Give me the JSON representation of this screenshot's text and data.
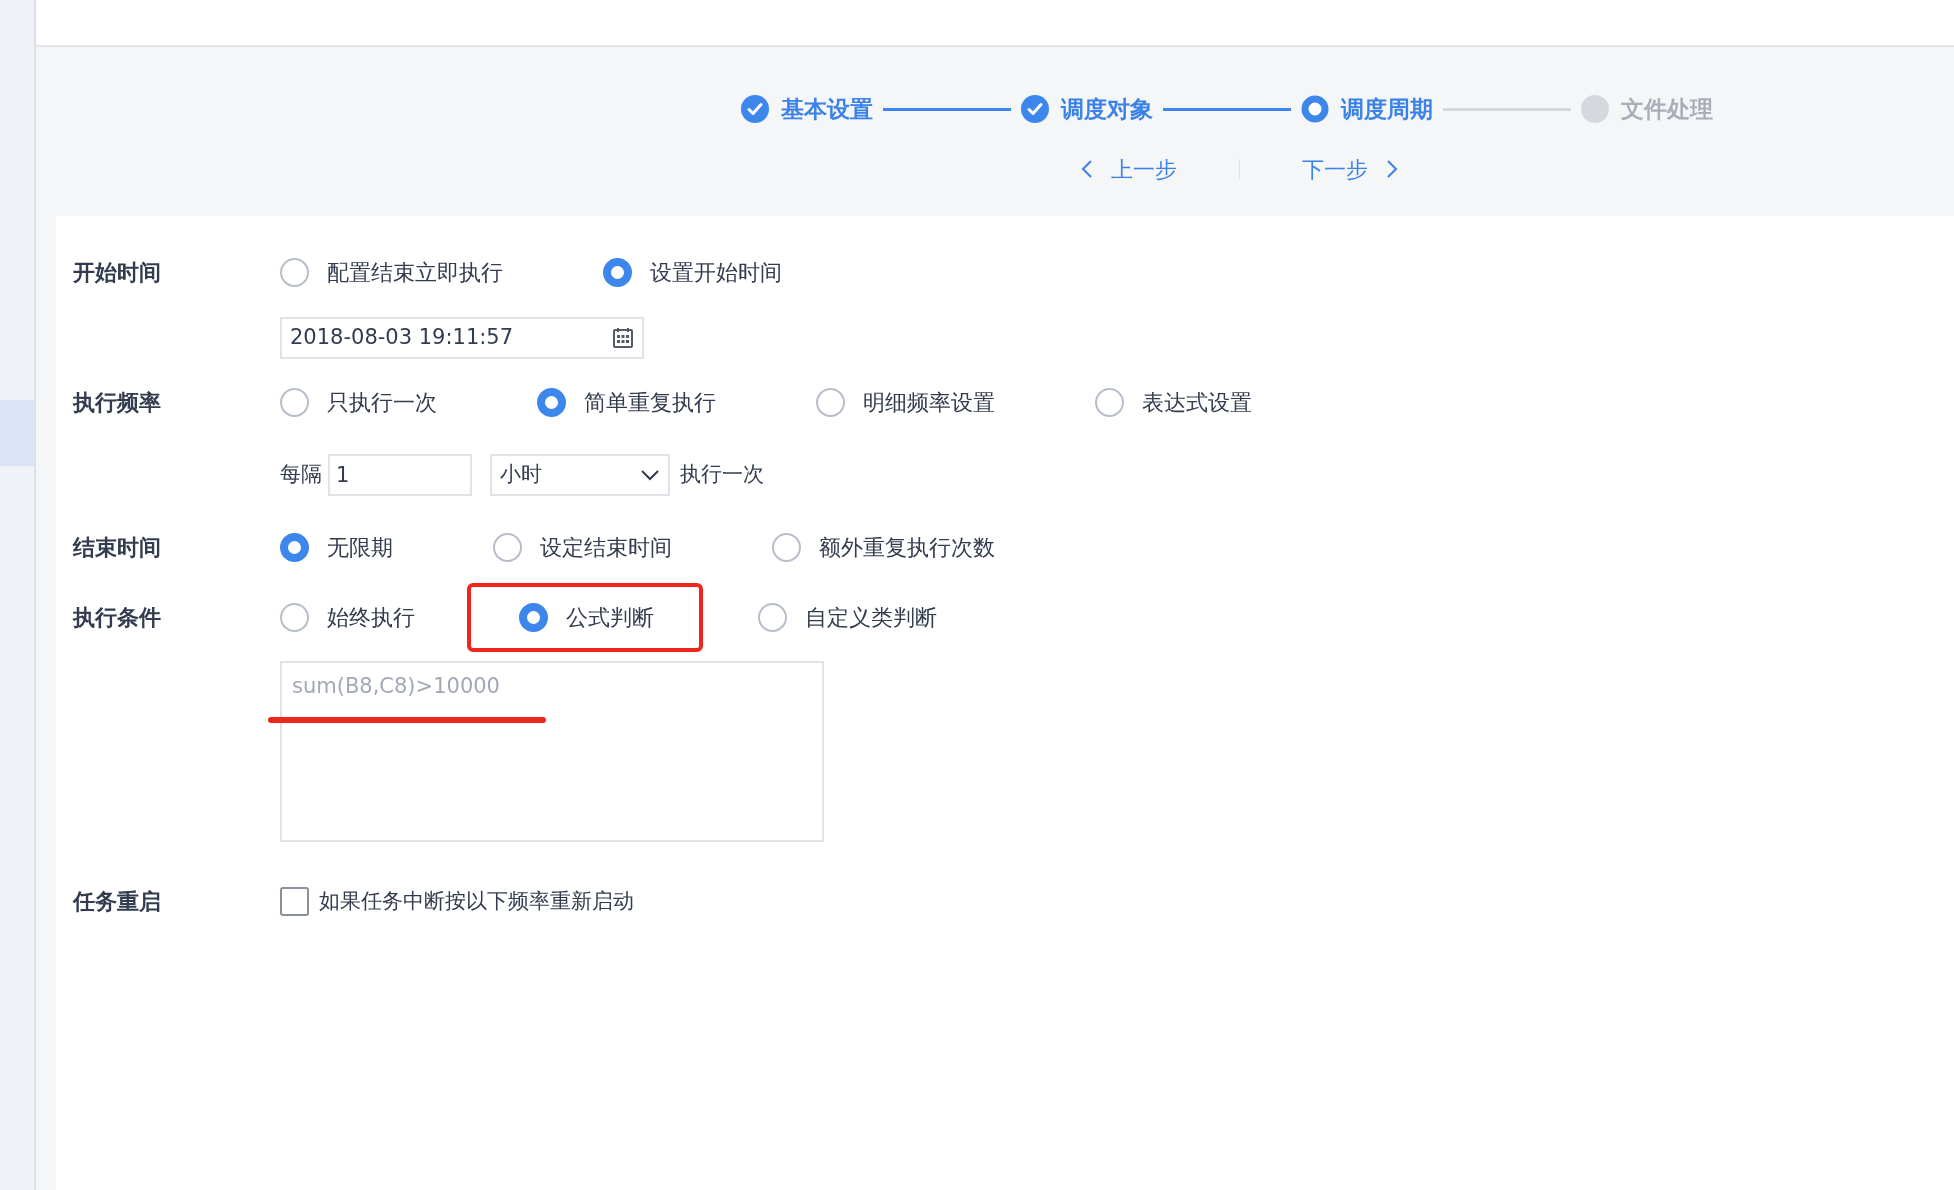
{
  "steps": [
    {
      "label": "基本设置",
      "completed": true,
      "selected": false
    },
    {
      "label": "调度对象",
      "completed": true,
      "selected": false
    },
    {
      "label": "调度周期",
      "completed": false,
      "selected": true
    },
    {
      "label": "文件处理",
      "completed": false,
      "selected": false
    }
  ],
  "nav": {
    "prev": "上一步",
    "next": "下一步"
  },
  "form": [
    {
      "label": "开始时间",
      "kind": "radios",
      "options": [
        {
          "label": "配置结束立即执行",
          "selected": false
        },
        {
          "label": "设置开始时间",
          "selected": true
        }
      ]
    },
    {
      "kind": "date",
      "value": "2018-08-03 19:11:57"
    },
    {
      "label": "执行频率",
      "kind": "radios",
      "options": [
        {
          "label": "只执行一次",
          "selected": false
        },
        {
          "label": "简单重复执行",
          "selected": true
        },
        {
          "label": "明细频率设置",
          "selected": false
        },
        {
          "label": "表达式设置",
          "selected": false
        }
      ]
    },
    {
      "kind": "interval",
      "prefix": "每隔",
      "value": "1",
      "unit": "小时",
      "suffix": "执行一次"
    },
    {
      "label": "结束时间",
      "kind": "radios",
      "options": [
        {
          "label": "无限期",
          "selected": true
        },
        {
          "label": "设定结束时间",
          "selected": false
        },
        {
          "label": "额外重复执行次数",
          "selected": false
        }
      ]
    },
    {
      "label": "执行条件",
      "kind": "radios",
      "options": [
        {
          "label": "始终执行",
          "selected": false
        },
        {
          "label": "公式判断",
          "selected": true,
          "highlighted": true
        },
        {
          "label": "自定义类判断",
          "selected": false
        }
      ]
    },
    {
      "kind": "textarea",
      "placeholder": "sum(B8,C8)>10000",
      "underlined": true
    },
    {
      "label": "任务重启",
      "kind": "checkbox",
      "text": "如果任务中断按以下频率重新启动",
      "checked": false
    }
  ]
}
